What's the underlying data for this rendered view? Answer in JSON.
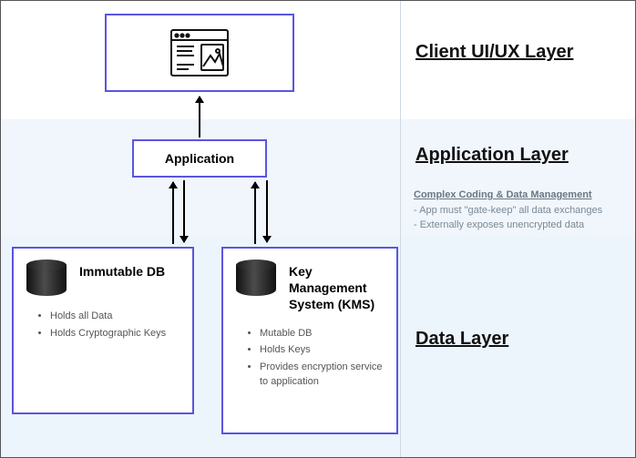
{
  "layers": {
    "client": "Client UI/UX Layer",
    "application": "Application Layer",
    "data": "Data Layer"
  },
  "application_box": {
    "label": "Application"
  },
  "note": {
    "title": "Complex Coding & Data Management",
    "line1": "-  App must \"gate-keep\" all data exchanges",
    "line2": "-  Externally exposes unencrypted data"
  },
  "immutable_db": {
    "title": "Immutable DB",
    "bullets": [
      "Holds all Data",
      "Holds Cryptographic Keys"
    ]
  },
  "kms": {
    "title": "Key Management System (KMS)",
    "bullets": [
      "Mutable DB",
      "Holds Keys",
      "Provides encryption service to application"
    ]
  }
}
